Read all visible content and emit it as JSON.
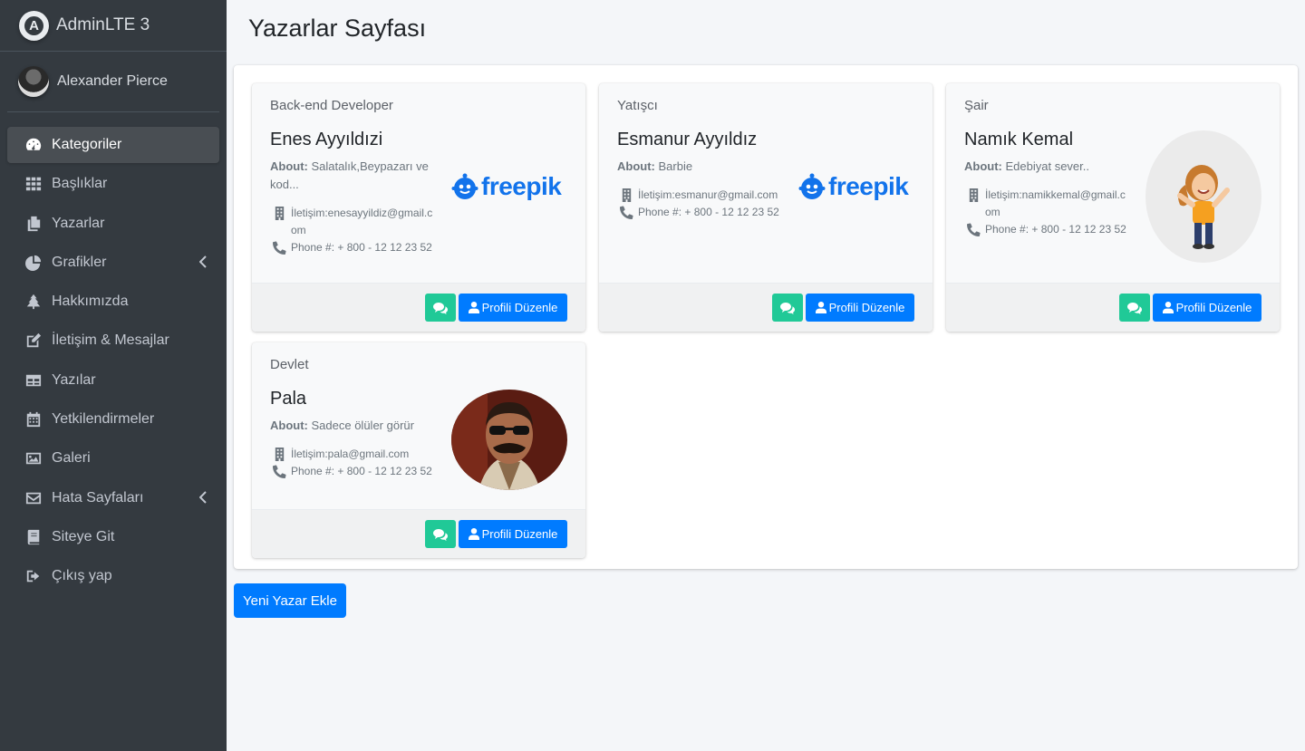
{
  "brand": {
    "name": "AdminLTE 3",
    "logo_letter": "A"
  },
  "user": {
    "name": "Alexander Pierce"
  },
  "sidebar": {
    "items": [
      {
        "label": "Kategoriler",
        "icon": "tachometer-icon",
        "active": true
      },
      {
        "label": "Başlıklar",
        "icon": "grid-icon"
      },
      {
        "label": "Yazarlar",
        "icon": "copy-icon"
      },
      {
        "label": "Grafikler",
        "icon": "pie-chart-icon",
        "has_arrow": true
      },
      {
        "label": "Hakkımızda",
        "icon": "tree-icon"
      },
      {
        "label": "İletişim & Mesajlar",
        "icon": "edit-icon"
      },
      {
        "label": "Yazılar",
        "icon": "table-icon"
      },
      {
        "label": "Yetkilendirmeler",
        "icon": "calendar-icon"
      },
      {
        "label": "Galeri",
        "icon": "image-icon"
      },
      {
        "label": "Hata Sayfaları",
        "icon": "envelope-icon",
        "has_arrow": true
      },
      {
        "label": "Siteye Git",
        "icon": "book-icon"
      },
      {
        "label": "Çıkış yap",
        "icon": "sign-out-icon"
      }
    ]
  },
  "page": {
    "title": "Yazarlar Sayfası",
    "add_button": "Yeni Yazar Ekle"
  },
  "cards": [
    {
      "role": "Back-end Developer",
      "name": "Enes Ayyıldızi",
      "about_label": "About:",
      "about": "Salatalık,Beypazarı ve kod...",
      "email": "İletişim:enesayyildiz@gmail.com",
      "phone": "Phone #: + 800 - 12 12 23 52",
      "image": "freepik-logo",
      "image_text": "freepik"
    },
    {
      "role": "Yatışcı",
      "name": "Esmanur Ayyıldız",
      "about_label": "About:",
      "about": "Barbie",
      "email": "İletişim:esmanur@gmail.com",
      "phone": "Phone #: + 800 - 12 12 23 52",
      "image": "freepik-logo",
      "image_text": "freepik"
    },
    {
      "role": "Şair",
      "name": "Namık Kemal",
      "about_label": "About:",
      "about": "Edebiyat sever..",
      "email": "İletişim:namikkemal@gmail.com",
      "phone": "Phone #: + 800 - 12 12 23 52",
      "image": "cartoon-girl-avatar"
    },
    {
      "role": "Devlet",
      "name": "Pala",
      "about_label": "About:",
      "about": "Sadece ölüler görür",
      "email": "İletişim:pala@gmail.com",
      "phone": "Phone #: + 800 - 12 12 23 52",
      "image": "man-with-sunglasses-photo"
    }
  ],
  "card_buttons": {
    "edit_label": "Profili Düzenle",
    "chat_icon": "comments-icon",
    "user_icon": "user-icon"
  },
  "colors": {
    "sidebar": "#343a40",
    "primary": "#007bff",
    "teal": "#20c997",
    "freepik": "#1273eb"
  }
}
